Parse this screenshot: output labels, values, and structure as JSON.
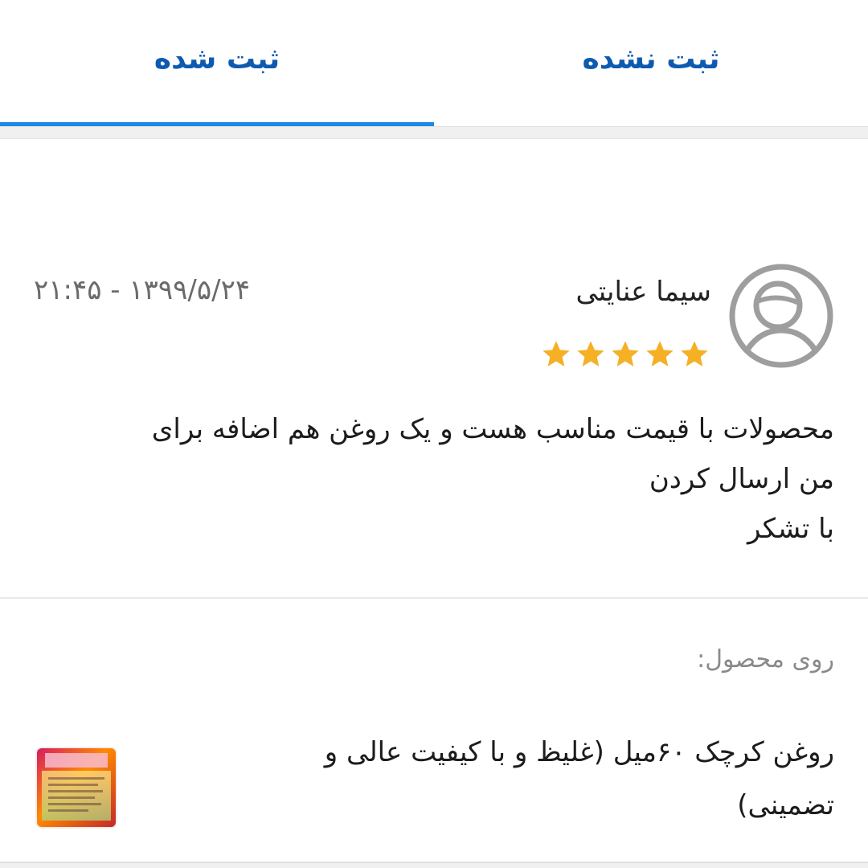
{
  "tabs": {
    "registered_label": "ثبت شده",
    "unregistered_label": "ثبت نشده",
    "active": "registered"
  },
  "review": {
    "author": "سیما عنایتی",
    "datetime": "۲۱:۴۵ - ۱۳۹۹/۵/۲۴",
    "rating": 5,
    "rating_max": 5,
    "comment_lines": [
      "محصولات با قیمت مناسب هست و یک روغن هم اضافه برای",
      "من ارسال کردن",
      "با تشکر"
    ],
    "on_product_label": "روی محصول:",
    "product_name": "روغن کرچک ۶۰میل (غلیظ و با کیفیت عالی و تضمینی)"
  },
  "colors": {
    "tab_text": "#0d5ab0",
    "tab_indicator": "#1e88e5",
    "star": "#f5b025",
    "avatar_stroke": "#9e9e9e"
  },
  "icons": {
    "avatar": "user-circle-icon",
    "star": "star-icon"
  }
}
